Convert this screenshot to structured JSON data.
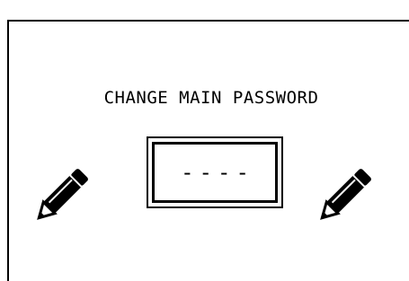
{
  "title": "CHANGE MAIN PASSWORD",
  "password_field": {
    "value": "----"
  },
  "icons": {
    "left": "pencil-icon",
    "right": "pencil-icon"
  },
  "colors": {
    "background": "#ffffff",
    "foreground": "#000000"
  }
}
